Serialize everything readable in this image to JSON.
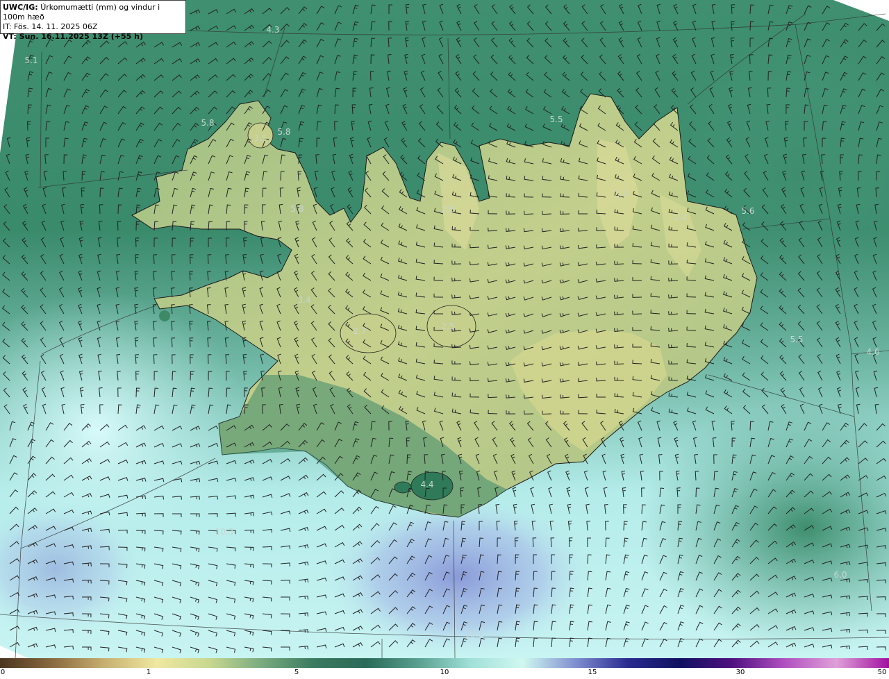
{
  "header": {
    "title_code": "UWC/IG:",
    "title_text": "Úrkomumætti (mm) og vindur i 100m hæð",
    "initial_time": "IT: Fös. 14. 11. 2025 06Z",
    "valid_time": "VT: Sun. 16.11.2025 13Z (+55 h)"
  },
  "map_labels": [
    {
      "text": "4.3"
    },
    {
      "text": "5.1"
    },
    {
      "text": "5.8"
    },
    {
      "text": "5.8"
    },
    {
      "text": "3.5"
    },
    {
      "text": "5.5"
    },
    {
      "text": "5.8"
    },
    {
      "text": "2.5"
    },
    {
      "text": "2.5"
    },
    {
      "text": "2.4"
    },
    {
      "text": "5.6"
    },
    {
      "text": "3.4"
    },
    {
      "text": "2.5"
    },
    {
      "text": "2.7"
    },
    {
      "text": "5.5"
    },
    {
      "text": "4.6"
    },
    {
      "text": "4.4"
    },
    {
      "text": "10.3"
    },
    {
      "text": "6.0"
    },
    {
      "text": "12.1"
    }
  ],
  "colorbar": {
    "ticks": [
      "0",
      "1",
      "5",
      "10",
      "15",
      "30",
      "50"
    ],
    "colors": [
      "#4a3520",
      "#8a6a40",
      "#c8b070",
      "#efe8a0",
      "#c8d890",
      "#7aab80",
      "#3a7a60",
      "#2a6a58",
      "#5aa090",
      "#a0e0d8",
      "#d0f8f0",
      "#8090d0",
      "#2a2a90",
      "#101060",
      "#501080",
      "#b050c0",
      "#e0a0d8",
      "#a010a0"
    ]
  }
}
